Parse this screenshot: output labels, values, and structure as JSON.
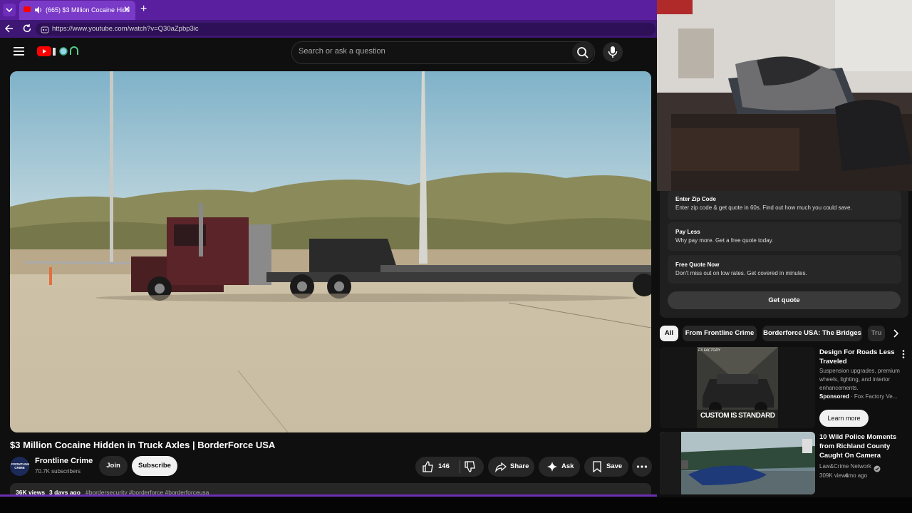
{
  "browser": {
    "tab_title": "(665) $3 Million Cocaine Hidd",
    "url": "https://www.youtube.com/watch?v=Q30aZpbp3ic",
    "new_tab_symbol": "+"
  },
  "header": {
    "search_placeholder": "Search or ask a question"
  },
  "video": {
    "title": "$3 Million Cocaine Hidden in Truck Axles | BorderForce USA",
    "channel_name": "Frontline Crime",
    "channel_avatar_text": "FRONTLINE CRIME",
    "subscribers": "70.7K subscribers",
    "join_label": "Join",
    "subscribe_label": "Subscribe",
    "likes": "146",
    "share_label": "Share",
    "ask_label": "Ask",
    "save_label": "Save",
    "views": "36K views",
    "age": "3 days ago",
    "hashtags": "#bordersecurity #borderforce #borderforceusa"
  },
  "ad": {
    "items": [
      {
        "title": "Enter Zip Code",
        "desc": "Enter zip code & get quote in 60s. Find out how much you could save."
      },
      {
        "title": "Pay Less",
        "desc": "Why pay more. Get a free quote today."
      },
      {
        "title": "Free Quote Now",
        "desc": "Don't miss out on low rates. Get covered in minutes."
      }
    ],
    "cta": "Get quote"
  },
  "chips": [
    "All",
    "From Frontline Crime",
    "Borderforce USA: The Bridges",
    "Tru"
  ],
  "recommendations": [
    {
      "title": "Design For Roads Less Traveled",
      "desc": "Suspension upgrades, premium wheels, lighting, and interior enhancements.",
      "sponsored": "Sponsored",
      "advertiser": "· Fox Factory Ve...",
      "cta": "Learn more",
      "thumb_text": "CUSTOM IS STANDARD",
      "thumb_logo": "FX FACTORY"
    },
    {
      "title": "10 Wild Police Moments from Richland County Caught On Camera",
      "channel": "Law&Crime Network",
      "views": "309K views",
      "age": "4mo ago"
    }
  ],
  "colors": {
    "accent_purple": "#6b2fb3",
    "youtube_red": "#ff0000"
  }
}
